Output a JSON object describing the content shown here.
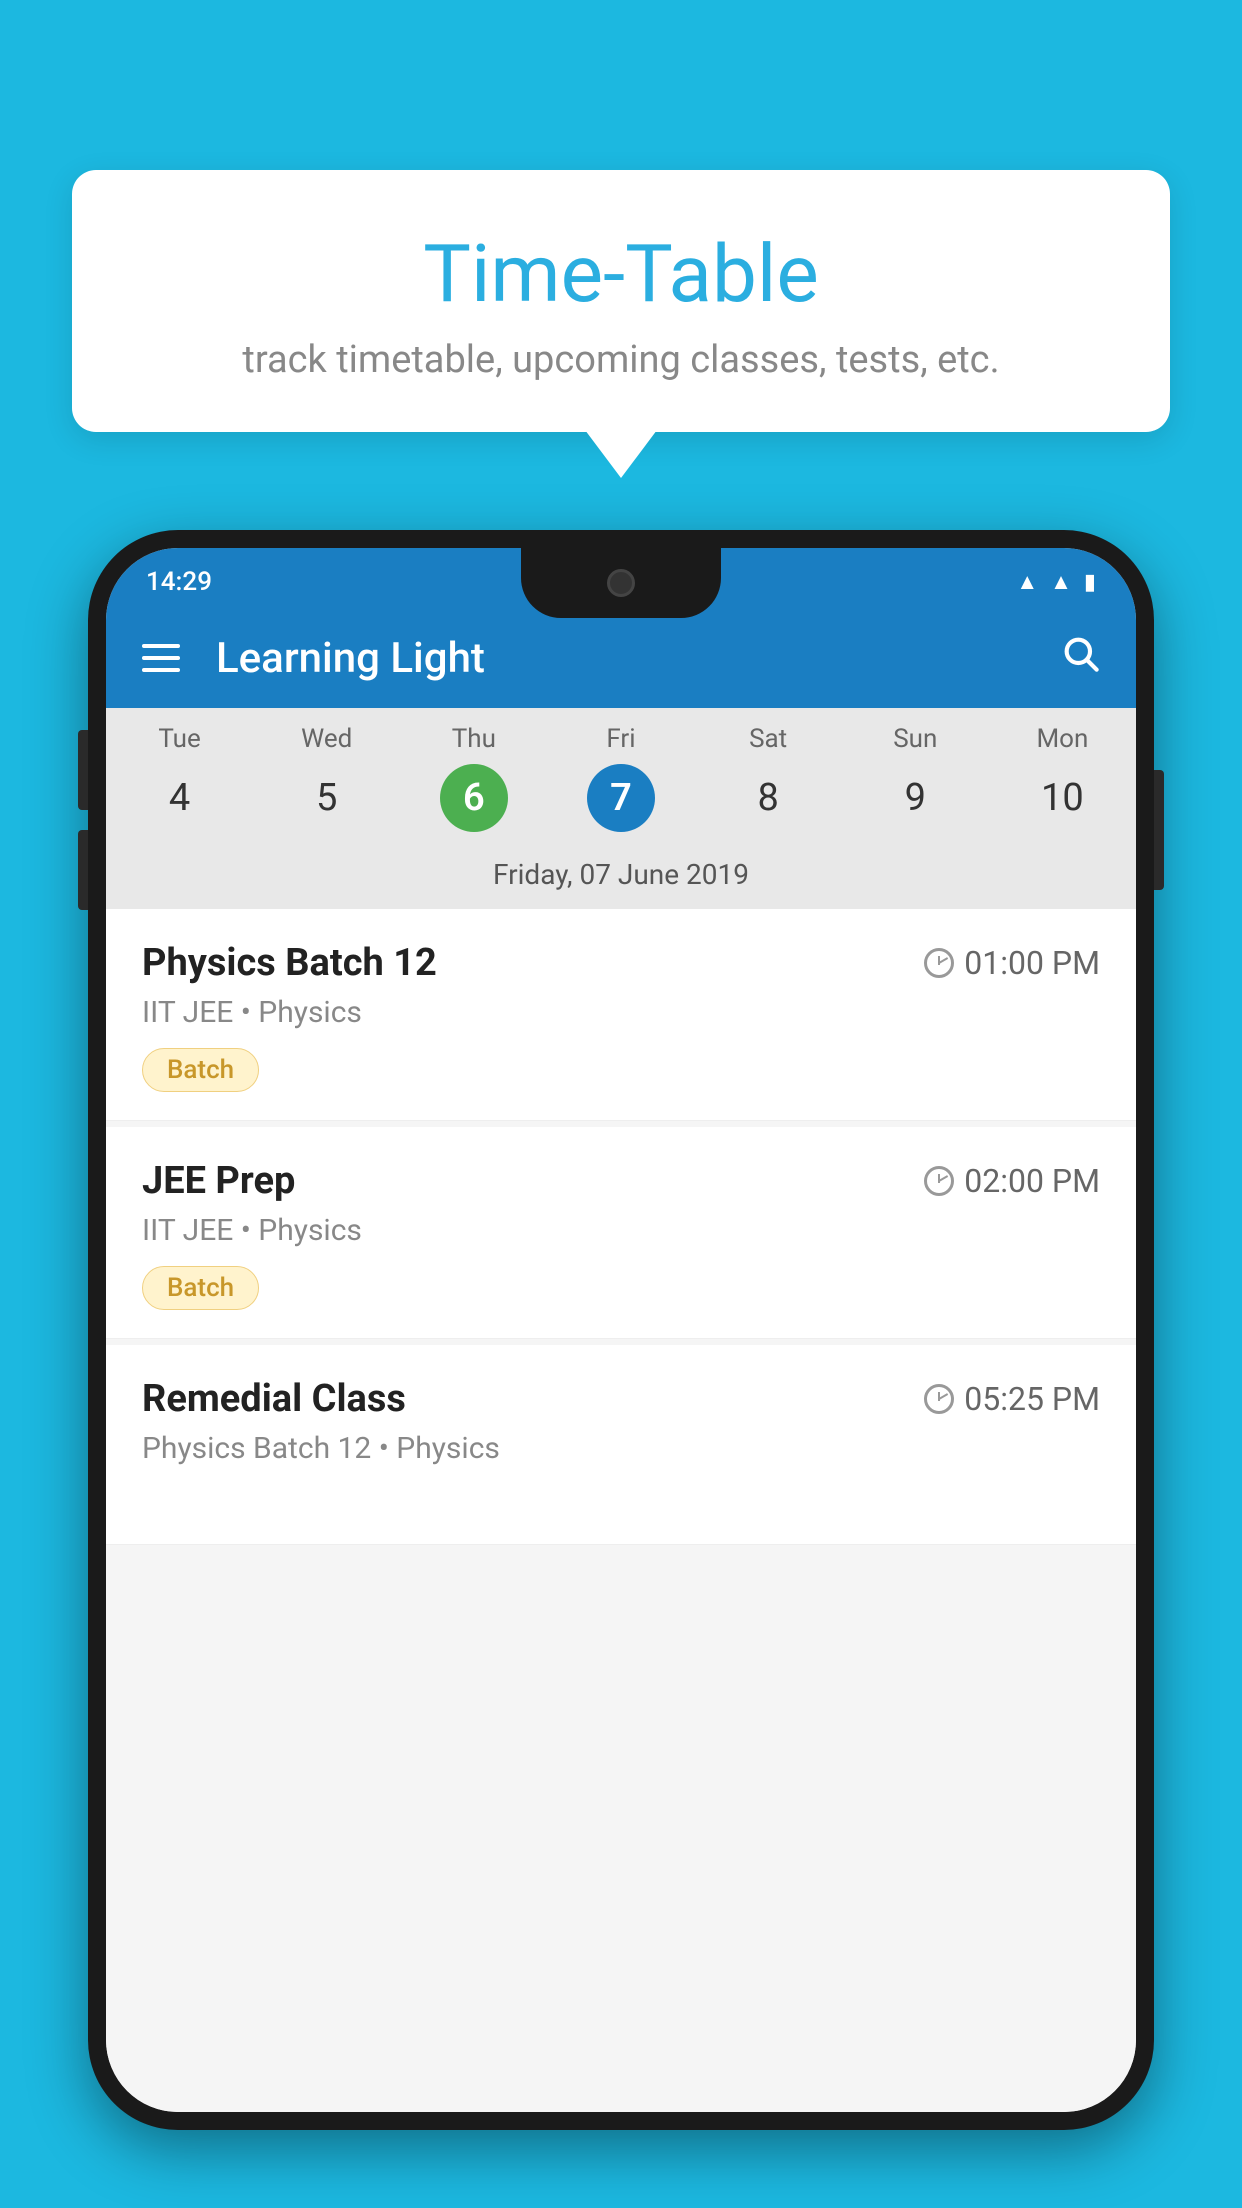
{
  "background": {
    "color": "#1CB8E0"
  },
  "speech_bubble": {
    "title": "Time-Table",
    "subtitle": "track timetable, upcoming classes, tests, etc."
  },
  "phone": {
    "status_bar": {
      "time": "14:29"
    },
    "app_bar": {
      "title": "Learning Light"
    },
    "calendar": {
      "days": [
        {
          "name": "Tue",
          "num": "4",
          "state": "normal"
        },
        {
          "name": "Wed",
          "num": "5",
          "state": "normal"
        },
        {
          "name": "Thu",
          "num": "6",
          "state": "today"
        },
        {
          "name": "Fri",
          "num": "7",
          "state": "selected"
        },
        {
          "name": "Sat",
          "num": "8",
          "state": "normal"
        },
        {
          "name": "Sun",
          "num": "9",
          "state": "normal"
        },
        {
          "name": "Mon",
          "num": "10",
          "state": "normal"
        }
      ],
      "selected_date_label": "Friday, 07 June 2019"
    },
    "schedule": [
      {
        "title": "Physics Batch 12",
        "time": "01:00 PM",
        "subtitle": "IIT JEE • Physics",
        "badge": "Batch"
      },
      {
        "title": "JEE Prep",
        "time": "02:00 PM",
        "subtitle": "IIT JEE • Physics",
        "badge": "Batch"
      },
      {
        "title": "Remedial Class",
        "time": "05:25 PM",
        "subtitle": "Physics Batch 12 • Physics",
        "badge": ""
      }
    ]
  }
}
